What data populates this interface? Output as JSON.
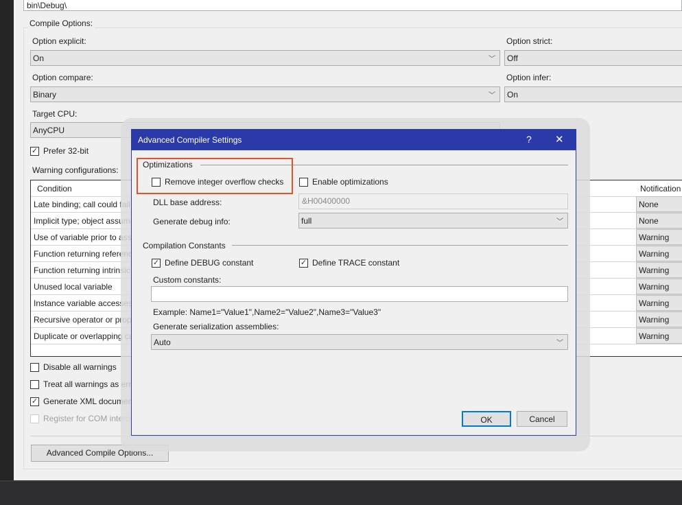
{
  "output_path": "bin\\Debug\\",
  "compile_options": {
    "group_label": "Compile Options:",
    "option_explicit": {
      "label": "Option explicit:",
      "value": "On"
    },
    "option_strict": {
      "label": "Option strict:",
      "value": "Off"
    },
    "option_compare": {
      "label": "Option compare:",
      "value": "Binary"
    },
    "option_infer": {
      "label": "Option infer:",
      "value": "On"
    },
    "target_cpu": {
      "label": "Target CPU:",
      "value": "AnyCPU"
    },
    "prefer_32bit": {
      "label": "Prefer 32-bit",
      "checked": true
    },
    "warning_label": "Warning configurations:",
    "columns": [
      "Condition",
      "Notification"
    ],
    "rows": [
      {
        "condition": "Late binding; call could fail",
        "notification": "None"
      },
      {
        "condition": "Implicit type; object assumed",
        "notification": "None"
      },
      {
        "condition": "Use of variable prior to assignment",
        "notification": "Warning"
      },
      {
        "condition": "Function returning reference type",
        "notification": "Warning"
      },
      {
        "condition": "Function returning intrinsic value type",
        "notification": "Warning"
      },
      {
        "condition": "Unused local variable",
        "notification": "Warning"
      },
      {
        "condition": "Instance variable accesses shared member",
        "notification": "Warning"
      },
      {
        "condition": "Recursive operator or property access",
        "notification": "Warning"
      },
      {
        "condition": "Duplicate or overlapping catch blocks",
        "notification": "Warning"
      }
    ],
    "disable_all_warnings": {
      "label": "Disable all warnings",
      "checked": false
    },
    "treat_warnings_as_errors": {
      "label": "Treat all warnings as errors",
      "checked": false
    },
    "generate_xml": {
      "label": "Generate XML documentation file",
      "checked": true
    },
    "register_com": {
      "label": "Register for COM interop",
      "checked": false,
      "disabled": true
    },
    "advanced_button": "Advanced Compile Options..."
  },
  "dialog": {
    "title": "Advanced Compiler Settings",
    "help": "?",
    "close": "✕",
    "optimizations_label": "Optimizations",
    "remove_overflow": {
      "label": "Remove integer overflow checks",
      "checked": false
    },
    "enable_optimizations": {
      "label": "Enable optimizations",
      "checked": false
    },
    "dll_base_label": "DLL base address:",
    "dll_base_value": "&H00400000",
    "debug_info_label": "Generate debug info:",
    "debug_info_value": "full",
    "constants_label": "Compilation Constants",
    "define_debug": {
      "label": "Define DEBUG constant",
      "checked": true
    },
    "define_trace": {
      "label": "Define TRACE constant",
      "checked": true
    },
    "custom_constants_label": "Custom constants:",
    "custom_constants_value": "",
    "example": "Example: Name1=\"Value1\",Name2=\"Value2\",Name3=\"Value3\"",
    "serialization_label": "Generate serialization assemblies:",
    "serialization_value": "Auto",
    "ok": "OK",
    "cancel": "Cancel",
    "highlight_color": "#e8502a"
  }
}
